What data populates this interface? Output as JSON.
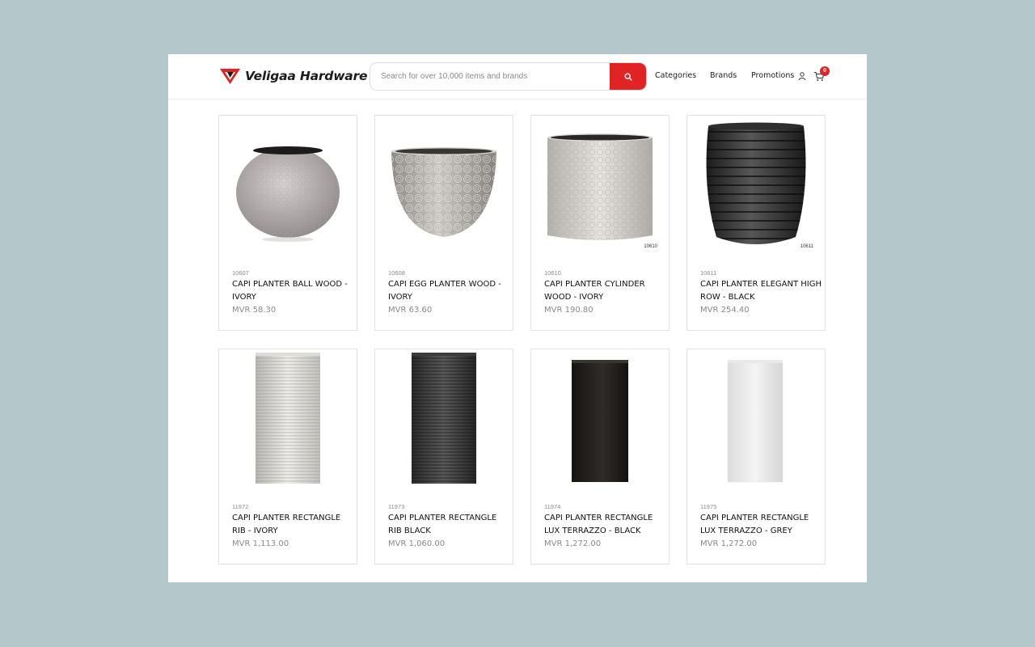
{
  "brand": {
    "name": "Veligaa Hardware"
  },
  "search": {
    "placeholder": "Search for over 10,000 items and brands"
  },
  "nav": {
    "categories": "Categories",
    "brands": "Brands",
    "promotions": "Promotions"
  },
  "cart": {
    "count": "0"
  },
  "colors": {
    "accent": "#e12323",
    "backdrop": "#b4c8cc"
  },
  "products": [
    {
      "sku": "10607",
      "name": "CAPI PLANTER BALL WOOD - IVORY",
      "price": "MVR 58.30",
      "image_label": ""
    },
    {
      "sku": "10608",
      "name": "CAPI EGG PLANTER WOOD - IVORY",
      "price": "MVR 63.60",
      "image_label": ""
    },
    {
      "sku": "10610",
      "name": "CAPI PLANTER CYLINDER WOOD - IVORY",
      "price": "MVR 190.80",
      "image_label": "10610"
    },
    {
      "sku": "10611",
      "name": "CAPI PLANTER ELEGANT HIGH ROW - BLACK",
      "price": "MVR 254.40",
      "image_label": "10611"
    },
    {
      "sku": "11972",
      "name": "CAPI PLANTER RECTANGLE RIB - IVORY",
      "price": "MVR 1,113.00",
      "image_label": ""
    },
    {
      "sku": "11973",
      "name": "CAPI PLANTER RECTANGLE RIB BLACK",
      "price": "MVR 1,060.00",
      "image_label": ""
    },
    {
      "sku": "11974",
      "name": "CAPI PLANTER RECTANGLE LUX TERRAZZO - BLACK",
      "price": "MVR 1,272.00",
      "image_label": ""
    },
    {
      "sku": "11975",
      "name": "CAPI PLANTER RECTANGLE LUX TERRAZZO - GREY",
      "price": "MVR 1,272.00",
      "image_label": ""
    }
  ]
}
